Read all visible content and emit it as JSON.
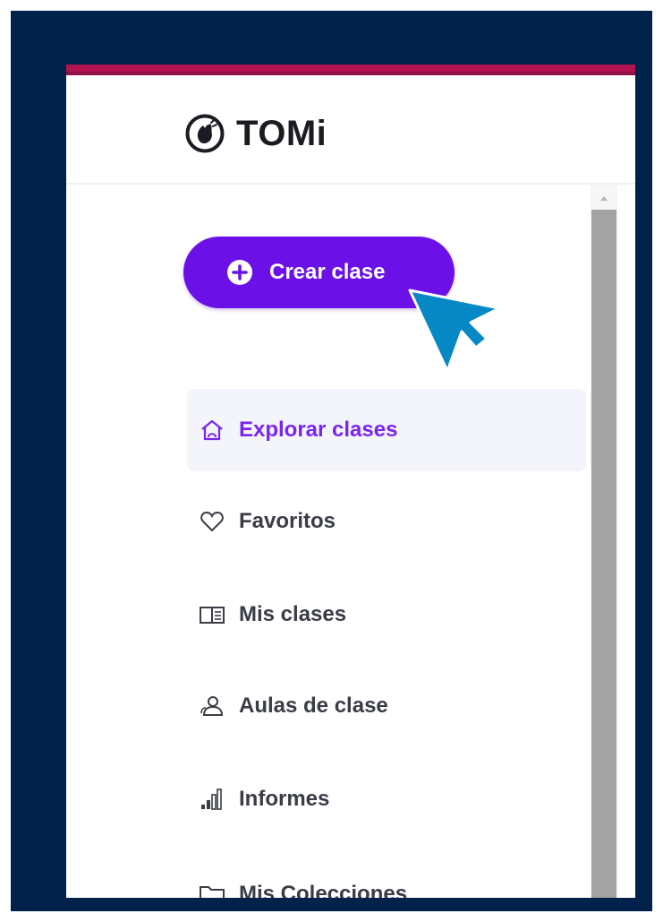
{
  "brand": {
    "name": "TOMi",
    "logo_icon": "hand-waving-icon"
  },
  "create_button": {
    "label": "Crear clase",
    "icon": "plus-circle-icon",
    "color": "#6b11e7"
  },
  "nav": {
    "items": [
      {
        "label": "Explorar clases",
        "icon": "home-icon",
        "active": true
      },
      {
        "label": "Favoritos",
        "icon": "heart-icon",
        "active": false
      },
      {
        "label": "Mis clases",
        "icon": "book-icon",
        "active": false
      },
      {
        "label": "Aulas de clase",
        "icon": "users-icon",
        "active": false
      },
      {
        "label": "Informes",
        "icon": "bar-chart-icon",
        "active": false
      },
      {
        "label": "Mis Colecciones",
        "icon": "folder-icon",
        "active": false
      }
    ]
  },
  "colors": {
    "frame": "#00214a",
    "accent_bar": "#b0134f",
    "active_text": "#7a25ee",
    "cursor": "#0588c4"
  }
}
